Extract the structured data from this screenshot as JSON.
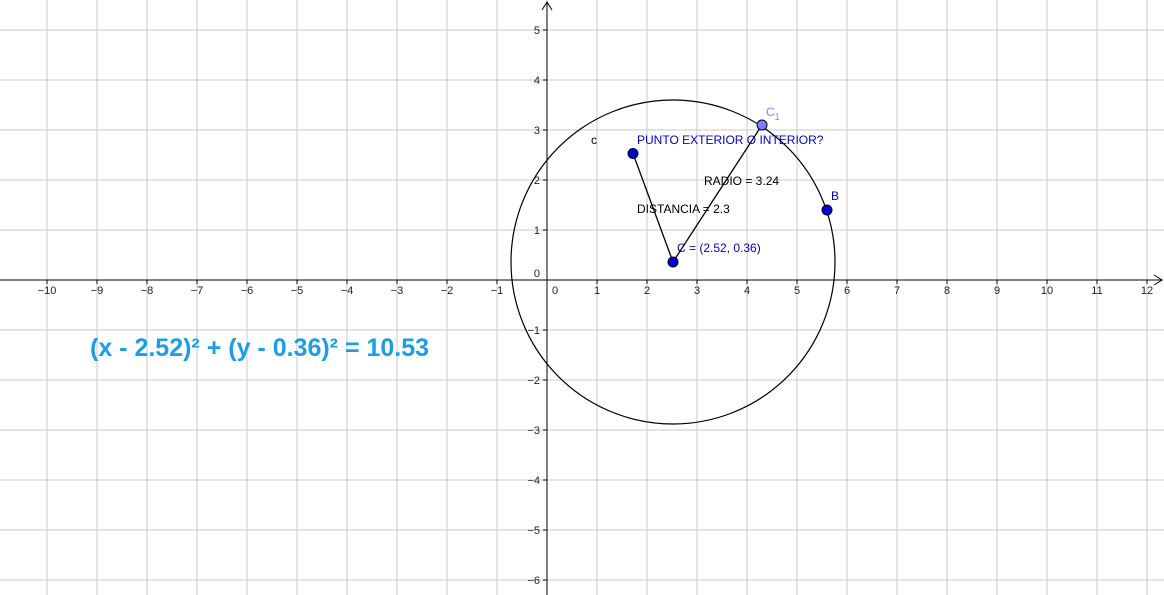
{
  "axes": {
    "x_ticks": [
      "−10",
      "−9",
      "−8",
      "−7",
      "−6",
      "−5",
      "−4",
      "−3",
      "−2",
      "−1",
      "0",
      "1",
      "2",
      "3",
      "4",
      "5",
      "6",
      "7",
      "8",
      "9",
      "10",
      "11",
      "12"
    ],
    "y_ticks_pos": [
      "1",
      "2",
      "3",
      "4",
      "5"
    ],
    "y_ticks_neg": [
      "−1",
      "−2",
      "−3",
      "−4",
      "−5",
      "−6"
    ],
    "grid": true
  },
  "circle": {
    "name": "c",
    "center": [
      2.52,
      0.36
    ],
    "radius": 3.24
  },
  "points": [
    {
      "name": "C",
      "label": "C = (2.52, 0.36)",
      "x": 2.52,
      "y": 0.36,
      "color": "#0000cc"
    },
    {
      "name": "B",
      "label": "B",
      "x": 5.6,
      "y": 1.4,
      "color": "#0000cc"
    },
    {
      "name": "C1",
      "label": "C",
      "subscript": "1",
      "x": 4.3,
      "y": 3.1,
      "color": "#7f7fff"
    },
    {
      "name": "P",
      "label": "",
      "x": 1.72,
      "y": 2.53,
      "color": "#0000cc"
    }
  ],
  "segments": [
    {
      "from": "C",
      "to": "P"
    },
    {
      "from": "C",
      "to": "C1"
    }
  ],
  "texts": {
    "question": "PUNTO EXTERIOR O INTERIOR?",
    "radio": "RADIO = 3.24",
    "distancia": "DISTANCIA = 2.3",
    "equation": "(x - 2.52)² + (y - 0.36)² = 10.53"
  },
  "colors": {
    "point": "#0000cc",
    "equation": "#1a9ee8",
    "grid": "#c8c8c8",
    "c1_point": "#7f7fff"
  }
}
